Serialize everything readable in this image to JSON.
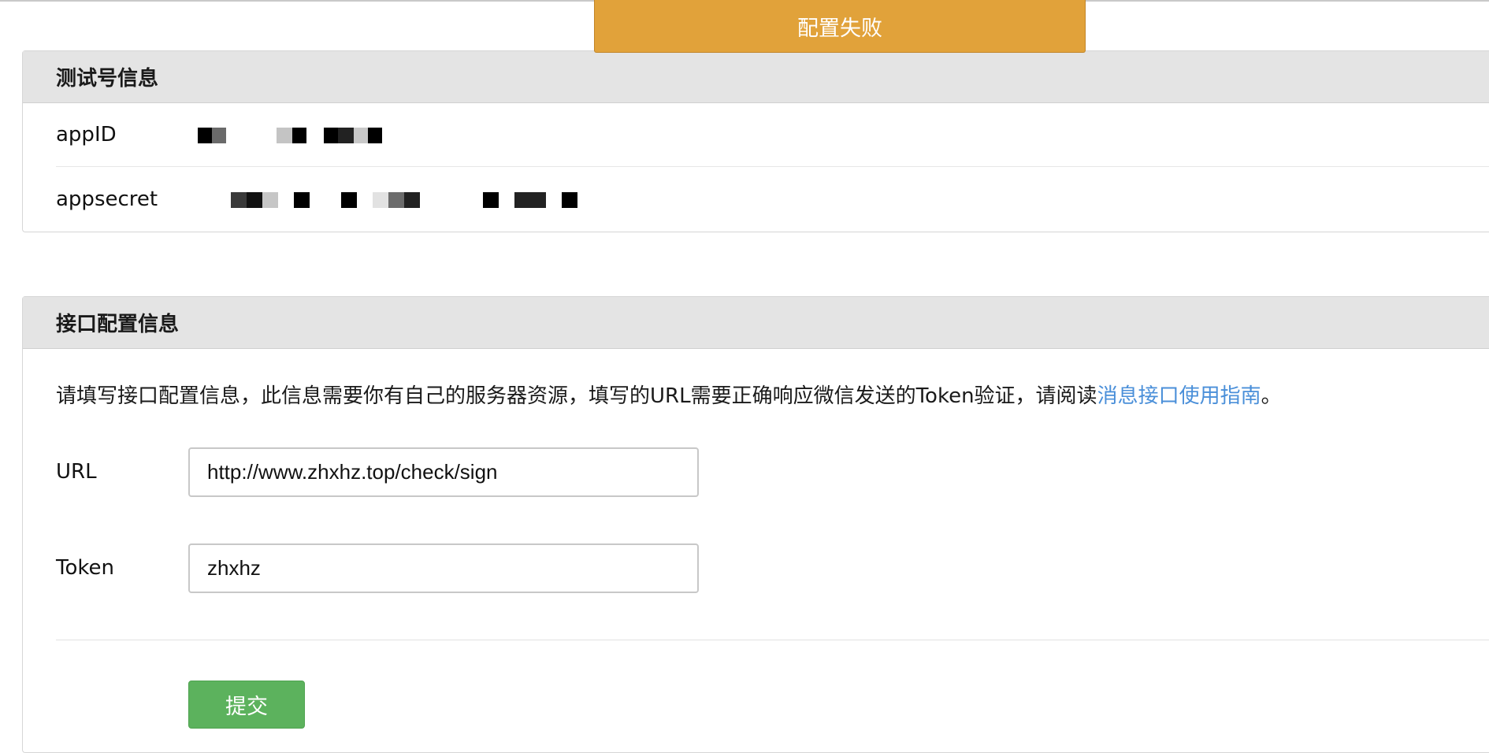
{
  "toast": {
    "message": "配置失败",
    "color": "#e1a23a"
  },
  "test_account_panel": {
    "title": "测试号信息",
    "rows": [
      {
        "label": "appID",
        "value_masked": true
      },
      {
        "label": "appsecret",
        "value_masked": true
      }
    ]
  },
  "interface_panel": {
    "title": "接口配置信息",
    "description": "请填写接口配置信息，此信息需要你有自己的服务器资源，填写的URL需要正确响应微信发送的Token验证，请阅读",
    "description_link": "消息接口使用指南",
    "description_end": "。",
    "fields": {
      "url": {
        "label": "URL",
        "value": "http://www.zhxhz.top/check/sign"
      },
      "token": {
        "label": "Token",
        "value": "zhxhz"
      }
    },
    "submit_label": "提交"
  },
  "colors": {
    "link": "#4a8fd9",
    "submit": "#5cb25d",
    "header_bg": "#e4e4e4"
  }
}
